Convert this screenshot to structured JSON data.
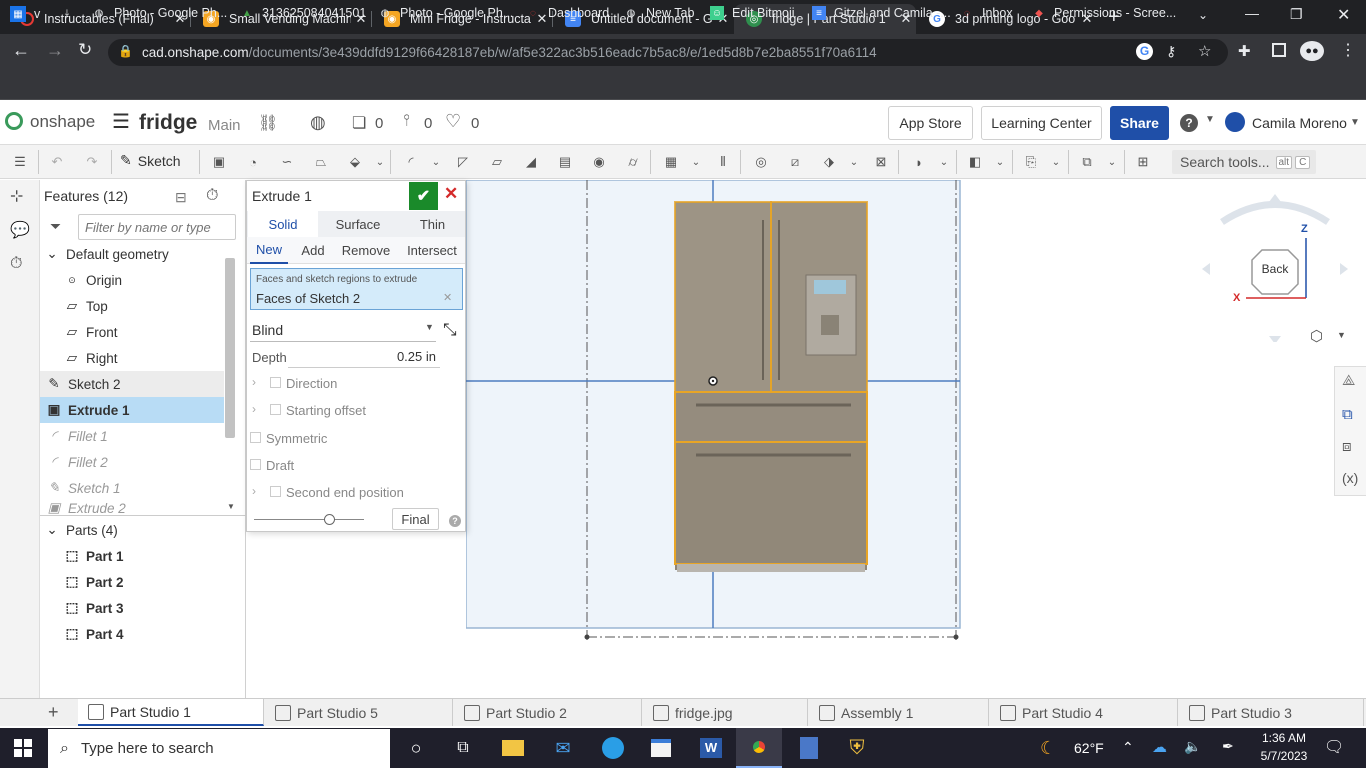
{
  "browser": {
    "tabs": [
      {
        "title": "Instructables (Final)",
        "active": false
      },
      {
        "title": "Small Vending Machin",
        "active": false
      },
      {
        "title": "Mini Fridge - Instructa",
        "active": false
      },
      {
        "title": "Untitled document - G",
        "active": false
      },
      {
        "title": "fridge | Part Studio 1",
        "active": true
      },
      {
        "title": "3d printing logo - Goo",
        "active": false
      }
    ],
    "url_host": "cad.onshape.com",
    "url_path": "/documents/3e439ddfd9129f66428187eb/w/af5e322ac3b516eadc7b5ac8/e/1ed5d8b7e2ba8551f70a6114",
    "bookmarks": [
      {
        "label": "v"
      },
      {
        "label": "Photo - Google Ph..."
      },
      {
        "label": "313625084041501"
      },
      {
        "label": "Photo - Google Ph..."
      },
      {
        "label": "Dashboard"
      },
      {
        "label": "New Tab"
      },
      {
        "label": "Edit Bitmoji"
      },
      {
        "label": "Gitzel and Camila -..."
      },
      {
        "label": "Inbox"
      },
      {
        "label": "Permissions - Scree..."
      }
    ]
  },
  "onshape": {
    "logo_text": "onshape",
    "doc_name": "fridge",
    "branch": "Main",
    "versions_count": "0",
    "pin_count": "0",
    "likes_count": "0",
    "app_store": "App Store",
    "learning_center": "Learning Center",
    "share": "Share",
    "user": "Camila Moreno",
    "toolbar": {
      "sketch_label": "Sketch",
      "search_placeholder": "Search tools...",
      "kbd_alt": "alt",
      "kbd_c": "C"
    }
  },
  "features": {
    "header": "Features (12)",
    "filter_placeholder": "Filter by name or type",
    "default_geometry": "Default geometry",
    "geometry_items": [
      "Origin",
      "Top",
      "Front",
      "Right"
    ],
    "items": [
      {
        "label": "Sketch 2",
        "state": "normal"
      },
      {
        "label": "Extrude 1",
        "state": "selected"
      },
      {
        "label": "Fillet 1",
        "state": "rolled-back"
      },
      {
        "label": "Fillet 2",
        "state": "rolled-back"
      },
      {
        "label": "Sketch 1",
        "state": "rolled-back"
      },
      {
        "label": "Extrude 2",
        "state": "rolled-back"
      }
    ],
    "parts_header": "Parts (4)",
    "parts": [
      "Part 1",
      "Part 2",
      "Part 3",
      "Part 4"
    ]
  },
  "dialog": {
    "title": "Extrude 1",
    "type_tabs": [
      "Solid",
      "Surface",
      "Thin"
    ],
    "op_tabs": [
      "New",
      "Add",
      "Remove",
      "Intersect"
    ],
    "selection_caption": "Faces and sketch regions to extrude",
    "selection_value": "Faces of Sketch 2",
    "end_type": "Blind",
    "depth_label": "Depth",
    "depth_value": "0.25 in",
    "direction": "Direction",
    "starting_offset": "Starting offset",
    "symmetric": "Symmetric",
    "draft": "Draft",
    "second_end": "Second end position",
    "final": "Final"
  },
  "viewcube": {
    "face": "Back",
    "axis_z": "Z",
    "axis_x": "X"
  },
  "bottom_tabs": [
    {
      "label": "Part Studio 1",
      "active": true
    },
    {
      "label": "Part Studio 5",
      "active": false
    },
    {
      "label": "Part Studio 2",
      "active": false
    },
    {
      "label": "fridge.jpg",
      "active": false
    },
    {
      "label": "Assembly 1",
      "active": false
    },
    {
      "label": "Part Studio 4",
      "active": false
    },
    {
      "label": "Part Studio 3",
      "active": false
    }
  ],
  "taskbar": {
    "search_placeholder": "Type here to search",
    "weather": "62°F",
    "time": "1:36 AM",
    "date": "5/7/2023"
  },
  "colors": {
    "onshape_blue": "#1f4fa8",
    "selection_blue": "#b8dcf5",
    "accept_green": "#1a8a2a",
    "cancel_red": "#d42a2a",
    "part_outline": "#e8a526"
  }
}
